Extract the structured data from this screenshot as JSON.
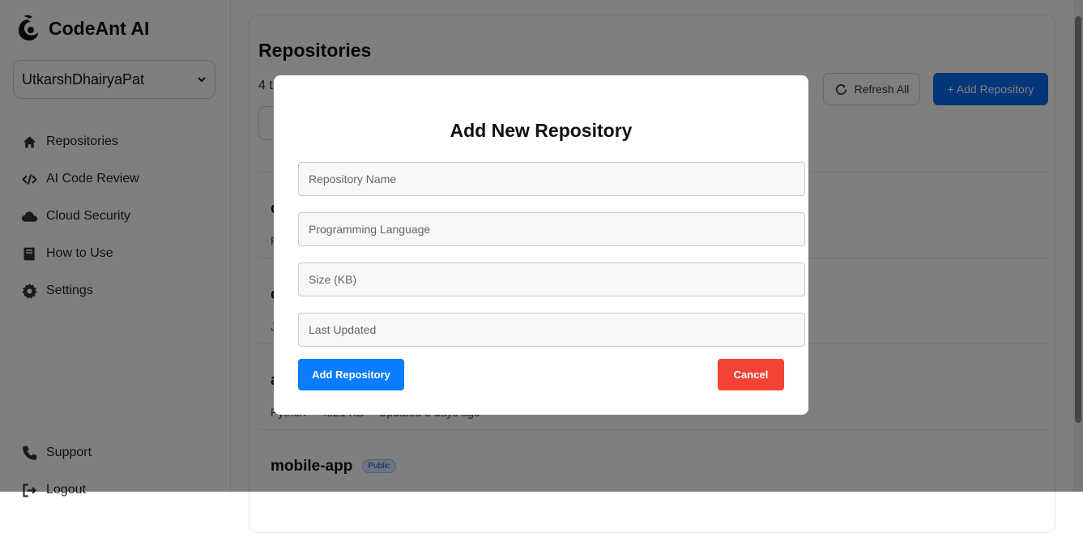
{
  "brand": {
    "name": "CodeAnt AI"
  },
  "sidebar": {
    "org": "UtkarshDhairyaPat",
    "items": [
      {
        "label": "Repositories",
        "icon": "home-icon"
      },
      {
        "label": "AI Code Review",
        "icon": "code-icon"
      },
      {
        "label": "Cloud Security",
        "icon": "cloud-icon"
      },
      {
        "label": "How to Use",
        "icon": "book-icon"
      },
      {
        "label": "Settings",
        "icon": "gear-icon"
      }
    ],
    "bottom": [
      {
        "label": "Support",
        "icon": "phone-icon"
      },
      {
        "label": "Logout",
        "icon": "logout-icon"
      }
    ]
  },
  "main": {
    "title": "Repositories",
    "count_text": "4 t",
    "refresh_label": "Refresh All",
    "add_label": "+ Add Repository",
    "repos": [
      {
        "name": "c",
        "meta1": "F",
        "meta2": "",
        "meta3": ""
      },
      {
        "name": "c",
        "meta1": "J",
        "meta2": "",
        "meta3": ""
      },
      {
        "name": "a",
        "meta1": "Python",
        "meta2": "4521 KB",
        "meta3": "Updated 5 days ago"
      },
      {
        "name": "mobile-app",
        "badge": "Public",
        "meta1": "",
        "meta2": "",
        "meta3": ""
      }
    ]
  },
  "modal": {
    "title": "Add New Repository",
    "fields": [
      {
        "placeholder": "Repository Name"
      },
      {
        "placeholder": "Programming Language"
      },
      {
        "placeholder": "Size (KB)"
      },
      {
        "placeholder": "Last Updated"
      }
    ],
    "add_label": "Add Repository",
    "cancel_label": "Cancel"
  },
  "colors": {
    "primary": "#0a7cff",
    "danger": "#f44336",
    "overlay": "rgba(0,0,0,0.5)"
  }
}
